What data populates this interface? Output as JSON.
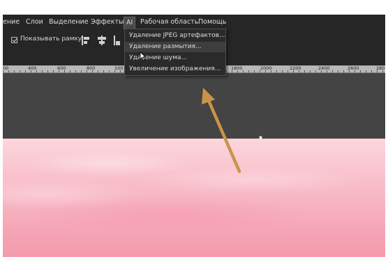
{
  "menubar": {
    "items": [
      {
        "label": "ение"
      },
      {
        "label": "Слои"
      },
      {
        "label": "Выделение"
      },
      {
        "label": "Эффекты"
      },
      {
        "label": "AI"
      },
      {
        "label": "Рабочая область"
      },
      {
        "label": "Помощь"
      }
    ]
  },
  "options": {
    "show_frame_label": "Показывать рамку",
    "show_frame_checked": true
  },
  "ruler": {
    "labels": [
      "00",
      "400",
      "600",
      "800",
      "100",
      "1800",
      "2000",
      "2200",
      "2400",
      "2600",
      "280"
    ]
  },
  "ai_menu": {
    "items": [
      {
        "label": "Удаление JPEG артефактов..."
      },
      {
        "label": "Удаление размытия..."
      },
      {
        "label": "Удаление шума..."
      },
      {
        "label": "Увеличение изображения..."
      }
    ],
    "hovered_index": 1
  },
  "colors": {
    "annotation_arrow": "#c9944a",
    "menu_bg": "#262626",
    "canvas_bg": "#444444",
    "photo_pink": "#f8bcc8"
  }
}
